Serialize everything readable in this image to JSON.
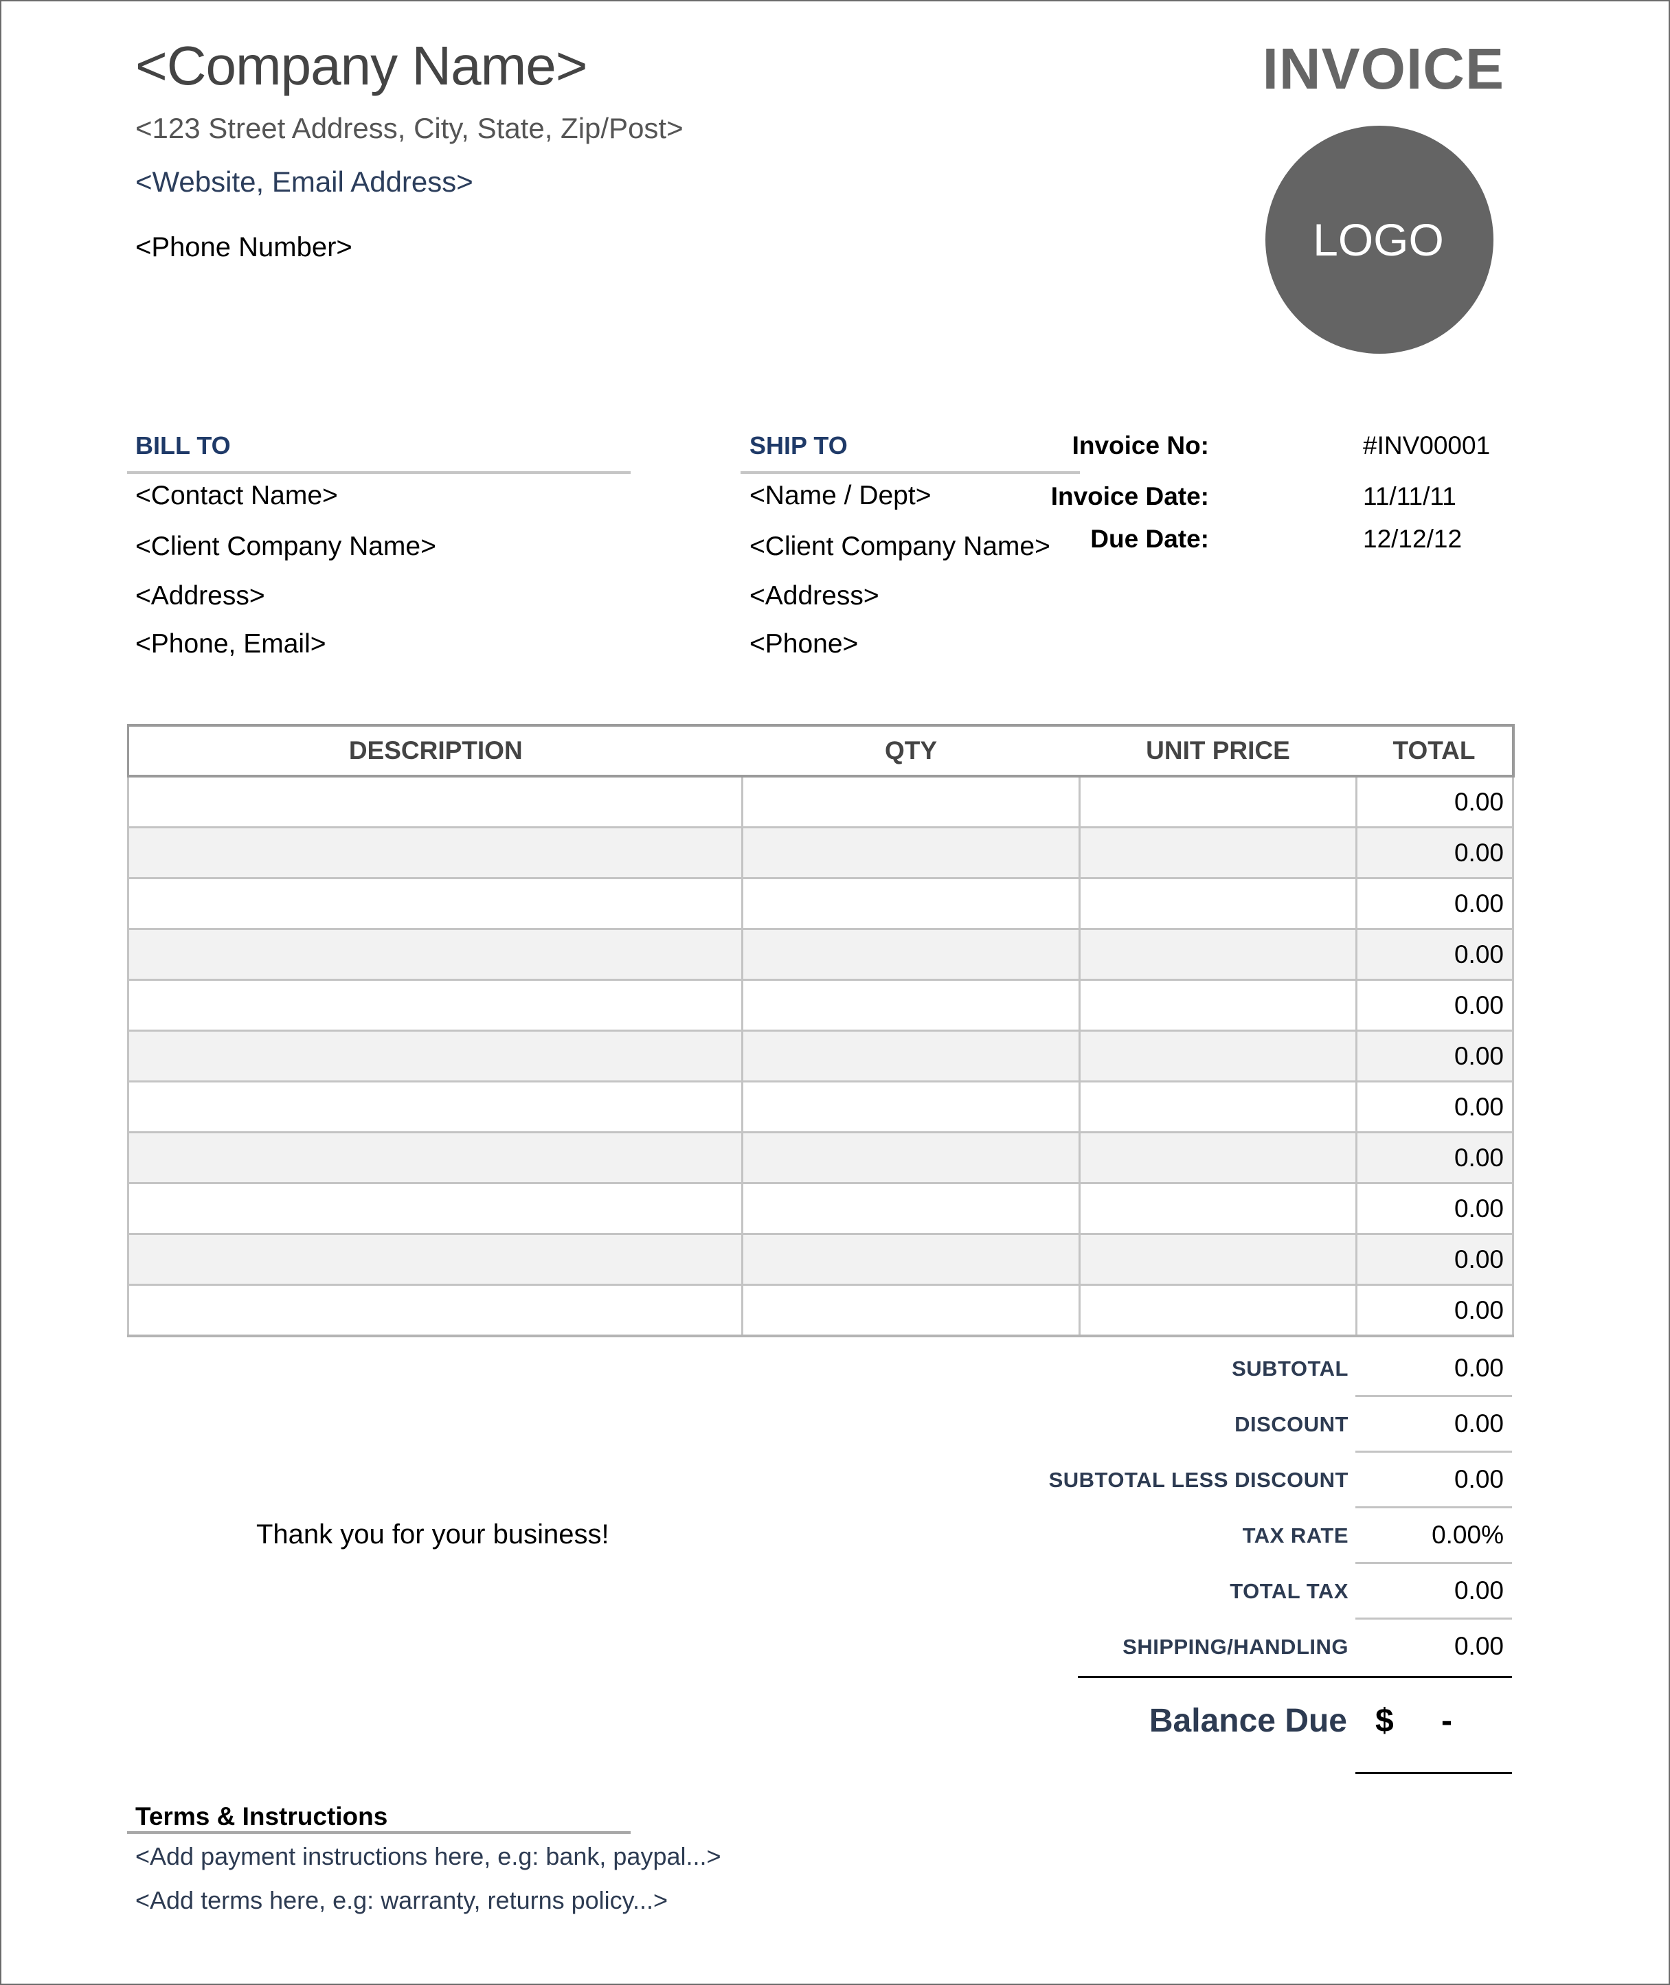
{
  "header": {
    "company_name": "<Company Name>",
    "street_address": "<123 Street Address, City, State, Zip/Post>",
    "website_email": "<Website, Email Address>",
    "phone": "<Phone Number>",
    "document_title": "INVOICE",
    "logo_text": "LOGO"
  },
  "bill_to": {
    "title": "BILL TO",
    "lines": [
      "<Contact Name>",
      "<Client Company Name>",
      "<Address>",
      "<Phone, Email>"
    ]
  },
  "ship_to": {
    "title": "SHIP TO",
    "lines": [
      "<Name / Dept>",
      "<Client Company Name>",
      "<Address>",
      "<Phone>"
    ]
  },
  "meta": {
    "invoice_no_label": "Invoice No:",
    "invoice_no": "#INV00001",
    "invoice_date_label": "Invoice Date:",
    "invoice_date": "11/11/11",
    "due_date_label": "Due Date:",
    "due_date": "12/12/12"
  },
  "items_table": {
    "columns": [
      "DESCRIPTION",
      "QTY",
      "UNIT PRICE",
      "TOTAL"
    ],
    "rows": [
      {
        "description": "",
        "qty": "",
        "unit_price": "",
        "total": "0.00"
      },
      {
        "description": "",
        "qty": "",
        "unit_price": "",
        "total": "0.00"
      },
      {
        "description": "",
        "qty": "",
        "unit_price": "",
        "total": "0.00"
      },
      {
        "description": "",
        "qty": "",
        "unit_price": "",
        "total": "0.00"
      },
      {
        "description": "",
        "qty": "",
        "unit_price": "",
        "total": "0.00"
      },
      {
        "description": "",
        "qty": "",
        "unit_price": "",
        "total": "0.00"
      },
      {
        "description": "",
        "qty": "",
        "unit_price": "",
        "total": "0.00"
      },
      {
        "description": "",
        "qty": "",
        "unit_price": "",
        "total": "0.00"
      },
      {
        "description": "",
        "qty": "",
        "unit_price": "",
        "total": "0.00"
      },
      {
        "description": "",
        "qty": "",
        "unit_price": "",
        "total": "0.00"
      },
      {
        "description": "",
        "qty": "",
        "unit_price": "",
        "total": "0.00"
      }
    ]
  },
  "totals": [
    {
      "label": "SUBTOTAL",
      "value": "0.00"
    },
    {
      "label": "DISCOUNT",
      "value": "0.00"
    },
    {
      "label": "SUBTOTAL LESS DISCOUNT",
      "value": "0.00"
    },
    {
      "label": "TAX RATE",
      "value": "0.00%"
    },
    {
      "label": "TOTAL TAX",
      "value": "0.00"
    },
    {
      "label": "SHIPPING/HANDLING",
      "value": "0.00"
    }
  ],
  "balance": {
    "label": "Balance Due",
    "currency": "$",
    "value": "-"
  },
  "thank_you": "Thank you for your business!",
  "terms": {
    "title": "Terms & Instructions",
    "payment_instructions": "<Add payment instructions here, e.g: bank, paypal...>",
    "terms_text": "<Add terms here, e.g: warranty, returns policy...>"
  },
  "colors": {
    "heading_navy": "#1f3a68",
    "label_slate": "#2d3b52",
    "logo_gray": "#646464",
    "title_gray": "#666666",
    "row_alt": "#f2f2f2"
  }
}
